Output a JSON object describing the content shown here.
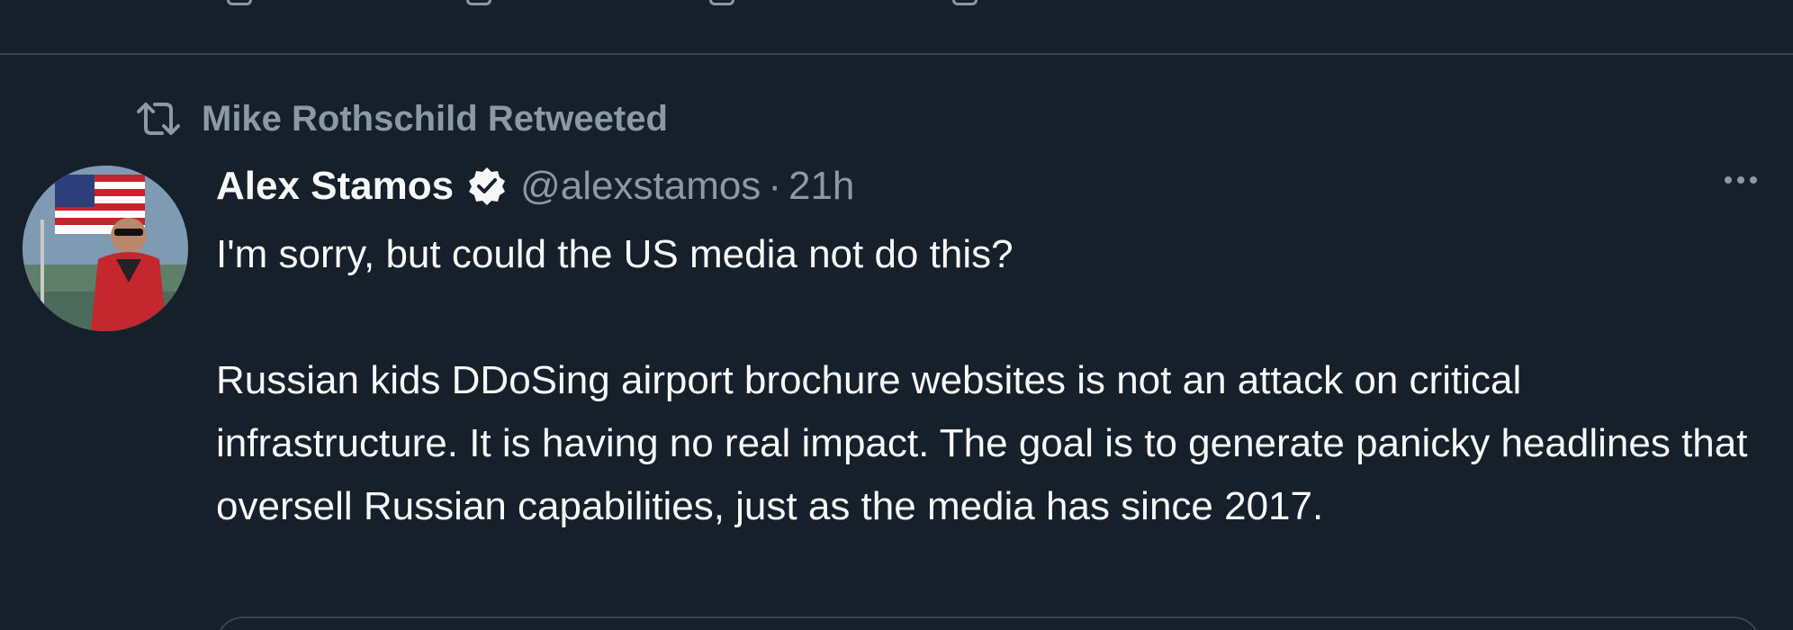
{
  "retweet": {
    "icon": "retweet-icon",
    "label": "Mike Rothschild Retweeted"
  },
  "tweet": {
    "author_name": "Alex Stamos",
    "verified_icon": "verified-badge-icon",
    "handle": "@alexstamos",
    "separator": "·",
    "time": "21h",
    "more_icon": "more-options-icon",
    "text_paragraph_1": "I'm sorry, but could the US media not do this?",
    "text_paragraph_2": "Russian kids DDoSing airport brochure websites is not an attack on critical infrastructure. It is having no real impact. The goal is to generate panicky headlines that oversell Russian capabilities, just as the media has since 2017."
  },
  "colors": {
    "background": "#15202b",
    "primary_text": "#f7f9f9",
    "secondary_text": "#8b98a5",
    "divider": "#38444d"
  }
}
